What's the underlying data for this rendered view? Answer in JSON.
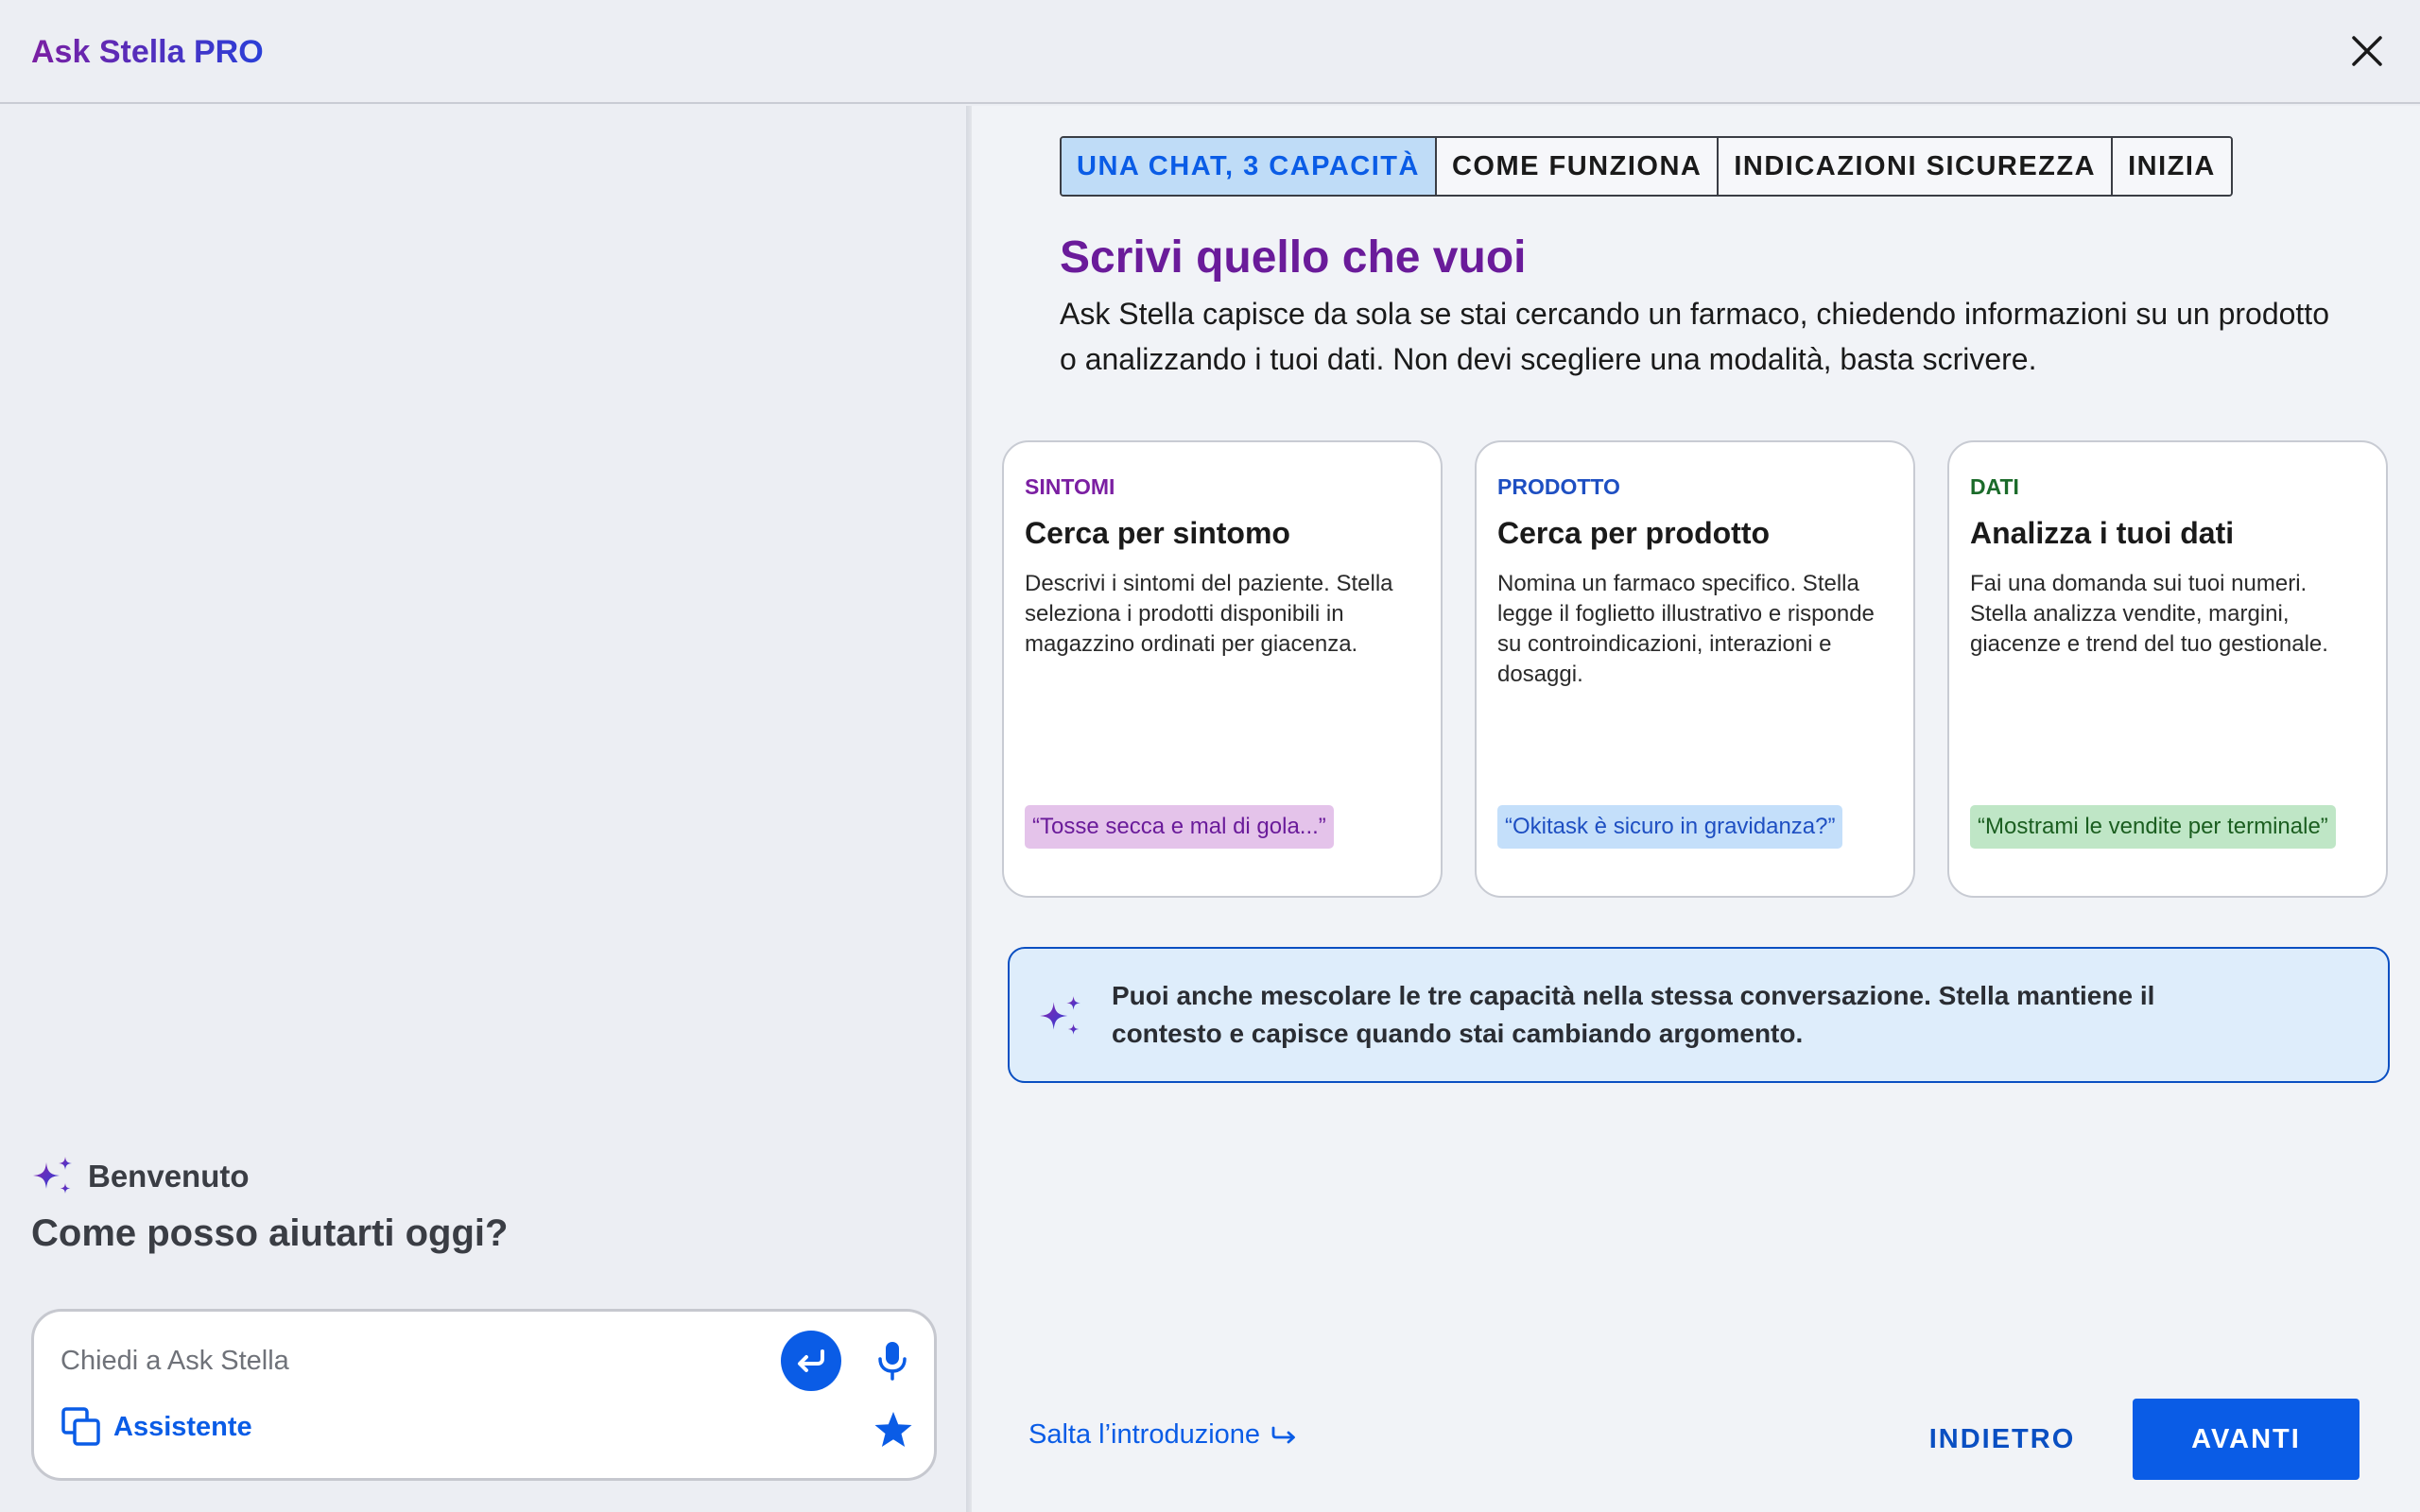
{
  "app": {
    "title": "Ask Stella PRO"
  },
  "chat": {
    "welcome": "Benvenuto",
    "greeting": "Come posso aiutarti oggi?",
    "input_placeholder": "Chiedi a Ask Stella",
    "mode_label": "Assistente"
  },
  "onboarding": {
    "tabs": [
      {
        "label": "UNA CHAT, 3 CAPACITÀ",
        "active": true
      },
      {
        "label": "COME FUNZIONA",
        "active": false
      },
      {
        "label": "INDICAZIONI SICUREZZA",
        "active": false
      },
      {
        "label": "INIZIA",
        "active": false
      }
    ],
    "title": "Scrivi quello che vuoi",
    "description": "Ask Stella capisce da sola se stai cercando un farmaco, chiedendo informazioni su un prodotto o analizzando i tuoi dati. Non devi scegliere una modalità, basta scrivere.",
    "cards": [
      {
        "category": "SINTOMI",
        "title": "Cerca per sintomo",
        "description": "Descrivi i sintomi del paziente. Stella seleziona i prodotti disponibili in magazzino ordinati per giacenza.",
        "example": "“Tosse secca e mal di gola...”",
        "accent": "#7b1fa2",
        "chip_bg": "#e4c3ea",
        "chip_color": "#6a1b9a"
      },
      {
        "category": "PRODOTTO",
        "title": "Cerca per prodotto",
        "description": "Nomina un farmaco specifico. Stella legge il foglietto illustrativo e risponde su controindicazioni, interazioni e dosaggi.",
        "example": "“Okitask è sicuro in gravidanza?”",
        "accent": "#1e4fc2",
        "chip_bg": "#c4dffa",
        "chip_color": "#1e4fc2"
      },
      {
        "category": "DATI",
        "title": "Analizza i tuoi dati",
        "description": "Fai una domanda sui tuoi numeri. Stella analizza vendite, margini, giacenze e trend del tuo gestionale.",
        "example": "“Mostrami le vendite per terminale”",
        "accent": "#1b6b2a",
        "chip_bg": "#bfe6c6",
        "chip_color": "#1b5e20"
      }
    ],
    "tip": "Puoi anche mescolare le tre capacità nella stessa conversazione. Stella mantiene il contesto e capisce quando stai cambiando argomento.",
    "skip_label": "Salta l’introduzione",
    "back_label": "INDIETRO",
    "next_label": "AVANTI"
  },
  "icons": {
    "close": "close-icon",
    "sparkle": "sparkle-icon",
    "send": "enter-icon",
    "mic": "microphone-icon",
    "assistant": "copy-squares-icon",
    "favorite": "star-icon",
    "skip_arrow": "hook-arrow-icon"
  },
  "colors": {
    "primary": "#0a5ce6",
    "title_purple": "#6a1b9a"
  }
}
